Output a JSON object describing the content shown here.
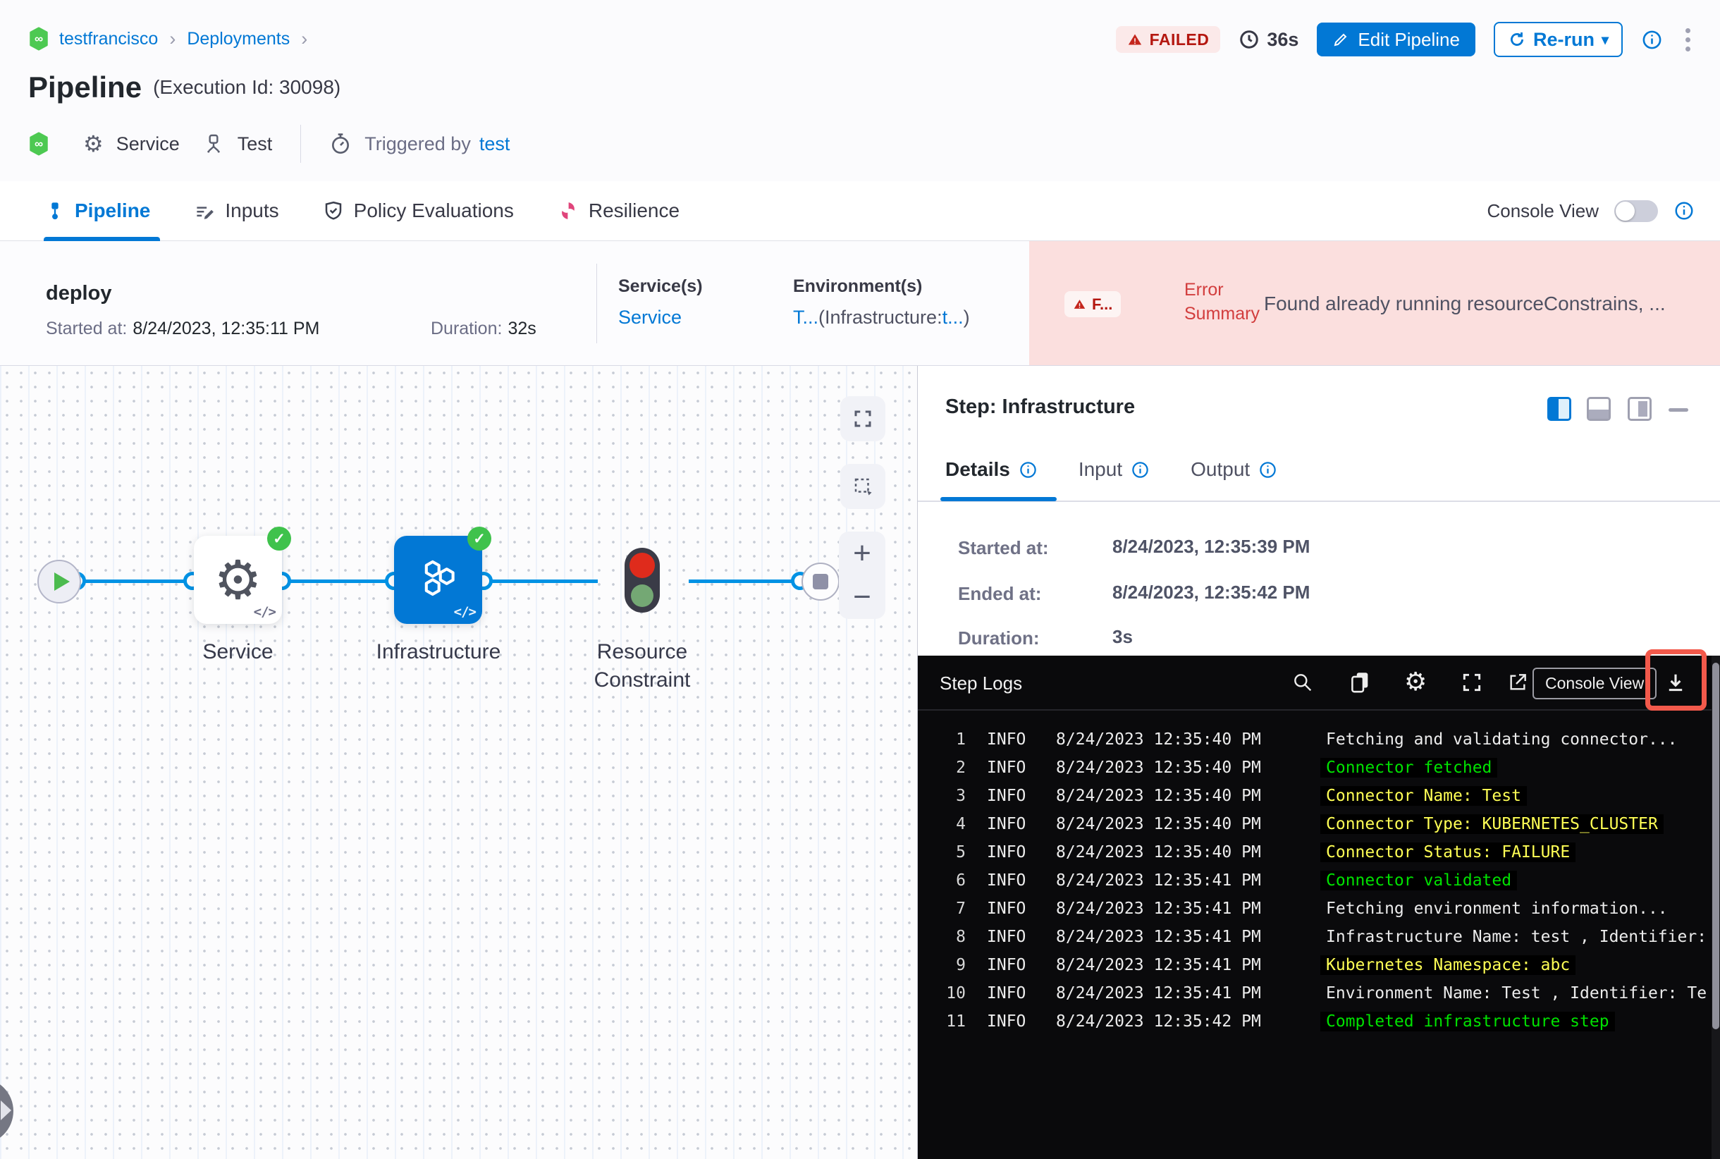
{
  "breadcrumb": {
    "account": "testfrancisco",
    "section": "Deployments",
    "separator": "›"
  },
  "header": {
    "title": "Pipeline",
    "execution_id": "(Execution Id: 30098)",
    "status_badge": "FAILED",
    "total_duration": "36s",
    "edit_button": "Edit Pipeline",
    "rerun_button": "Re-run",
    "caret": "▾",
    "service_label": "Service",
    "environment_label": "Test",
    "triggered_by_label": "Triggered by",
    "trigger_user": "test"
  },
  "tabs": {
    "pipeline": "Pipeline",
    "inputs": "Inputs",
    "policy": "Policy Evaluations",
    "resilience": "Resilience",
    "console_view_label": "Console View"
  },
  "stage": {
    "name": "deploy",
    "started_label": "Started at:",
    "started_value": "8/24/2023, 12:35:11 PM",
    "duration_label": "Duration:",
    "duration_value": "32s",
    "services_label": "Service(s)",
    "services_value": "Service",
    "environments_label": "Environment(s)",
    "env_name": "T...",
    "env_mid": "(Infrastructure:",
    "env_infra": "t...",
    "env_close": ")",
    "failed_chip": "F...",
    "error_summary_label_line1": "Error",
    "error_summary_label_line2": "Summary",
    "error_summary_text": "Found already running resourceConstrains, ..."
  },
  "graph": {
    "nodes": [
      {
        "label": "Service"
      },
      {
        "label": "Infrastructure"
      },
      {
        "label": "Resource Constraint"
      }
    ],
    "code_glyph": "</>",
    "zoom_in": "+",
    "zoom_out": "−",
    "check": "✓"
  },
  "panel": {
    "title": "Step: Infrastructure",
    "tabs": {
      "details": "Details",
      "input": "Input",
      "output": "Output"
    },
    "details": {
      "started_label": "Started at:",
      "started_value": "8/24/2023, 12:35:39 PM",
      "ended_label": "Ended at:",
      "ended_value": "8/24/2023, 12:35:42 PM",
      "duration_label": "Duration:",
      "duration_value": "3s"
    }
  },
  "logs": {
    "title": "Step Logs",
    "console_view_button": "Console View",
    "level": "INFO",
    "colors": {
      "white": "#ECECEC",
      "green": "#00E100",
      "yellow": "#FFFF55"
    },
    "entries": [
      {
        "n": "1",
        "time": "8/24/2023 12:35:40 PM",
        "msg": "Fetching and validating connector...",
        "color": "white"
      },
      {
        "n": "2",
        "time": "8/24/2023 12:35:40 PM",
        "msg": "Connector fetched",
        "color": "green"
      },
      {
        "n": "3",
        "time": "8/24/2023 12:35:40 PM",
        "msg": "Connector Name: Test",
        "color": "yellow"
      },
      {
        "n": "4",
        "time": "8/24/2023 12:35:40 PM",
        "msg": "Connector Type: KUBERNETES_CLUSTER",
        "color": "yellow"
      },
      {
        "n": "5",
        "time": "8/24/2023 12:35:40 PM",
        "msg": "Connector Status: FAILURE",
        "color": "yellow"
      },
      {
        "n": "6",
        "time": "8/24/2023 12:35:41 PM",
        "msg": "Connector validated",
        "color": "green"
      },
      {
        "n": "7",
        "time": "8/24/2023 12:35:41 PM",
        "msg": "Fetching environment information...",
        "color": "white"
      },
      {
        "n": "8",
        "time": "8/24/2023 12:35:41 PM",
        "msg": "Infrastructure Name: test , Identifier:",
        "color": "white"
      },
      {
        "n": "9",
        "time": "8/24/2023 12:35:41 PM",
        "msg": "Kubernetes Namespace: abc",
        "color": "yellow"
      },
      {
        "n": "10",
        "time": "8/24/2023 12:35:41 PM",
        "msg": "Environment Name: Test , Identifier: Te",
        "color": "white"
      },
      {
        "n": "11",
        "time": "8/24/2023 12:35:42 PM",
        "msg": "Completed infrastructure step",
        "color": "green"
      }
    ]
  },
  "colors": {
    "accent_blue": "#0278D5",
    "link_blue": "#0278D5",
    "success_green": "#3FC24C",
    "failed_red": "#B41710",
    "error_bg": "#FBDFDE",
    "resilience_pink": "#E0457B",
    "annotation_red": "#F2594B",
    "console_bg": "#0A0A0C"
  },
  "icons_text": {
    "infinity": "∞",
    "gear": "⚙"
  }
}
